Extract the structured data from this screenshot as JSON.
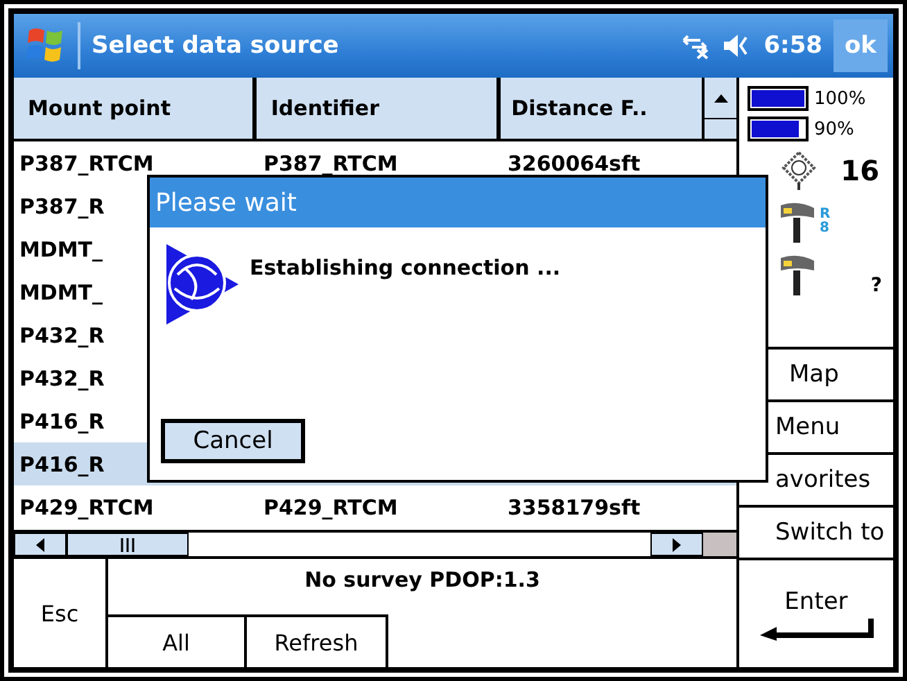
{
  "title_bar": {
    "title": "Select data source",
    "time": "6:58",
    "ok": "ok"
  },
  "table": {
    "columns": [
      "Mount point",
      "Identifier",
      "Distance F.."
    ],
    "rows": [
      {
        "cells": [
          "P387_RTCM",
          "P387_RTCM",
          "3260064sft"
        ],
        "selected": false
      },
      {
        "cells": [
          "P387_R"
        ],
        "selected": false
      },
      {
        "cells": [
          "MDMT_"
        ],
        "selected": false
      },
      {
        "cells": [
          "MDMT_"
        ],
        "selected": false
      },
      {
        "cells": [
          "P432_R"
        ],
        "selected": false
      },
      {
        "cells": [
          "P432_R"
        ],
        "selected": false
      },
      {
        "cells": [
          "P416_R"
        ],
        "selected": false
      },
      {
        "cells": [
          "P416_R"
        ],
        "selected": true
      },
      {
        "cells": [
          "P429_RTCM",
          "P429_RTCM",
          "3358179sft"
        ],
        "selected": false
      }
    ]
  },
  "status_panel": {
    "batteries": [
      {
        "level": 1.0,
        "reading": "100%"
      },
      {
        "level": 0.9,
        "reading": "90%"
      }
    ],
    "satellites": "16",
    "receivers": [
      {
        "label": "R8"
      },
      {
        "label": "?"
      }
    ]
  },
  "side_buttons": [
    "Map",
    "Menu",
    "avorites",
    "Switch to"
  ],
  "bottom_bar": {
    "esc": "Esc",
    "status": "No survey  PDOP:1.3",
    "tabs": [
      "All",
      "Refresh"
    ],
    "enter": "Enter"
  },
  "dialog": {
    "title": "Please wait",
    "message": "Establishing connection ...",
    "button": "Cancel"
  }
}
